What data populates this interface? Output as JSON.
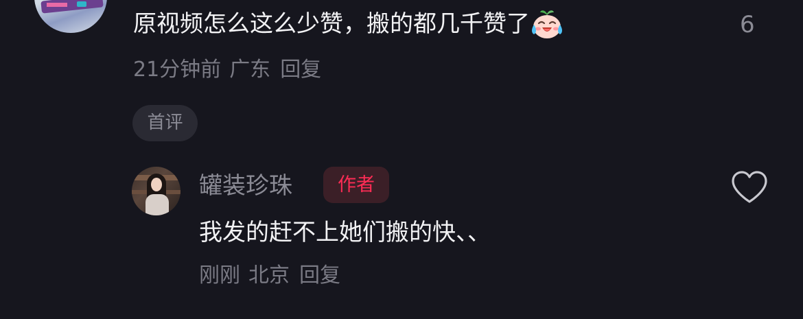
{
  "comment": {
    "text": "原视频怎么这么少赞，搬的都几千赞了",
    "emoji": "crying-laughing-face",
    "like_count": "6",
    "time": "21分钟前",
    "location": "广东",
    "reply_label": "回复",
    "first_badge": "首评"
  },
  "reply": {
    "author_name": "罐装珍珠",
    "author_badge": "作者",
    "text": "我发的赶不上她们搬的快、、",
    "time": "刚刚",
    "location": "北京",
    "reply_label": "回复",
    "like_icon": "heart-outline-icon"
  },
  "colors": {
    "background": "#16161e",
    "primary_text": "#f2f2f4",
    "secondary_text": "#7b7b85",
    "author_badge_text": "#fe2c55",
    "author_badge_bg": "#3b1f27"
  }
}
